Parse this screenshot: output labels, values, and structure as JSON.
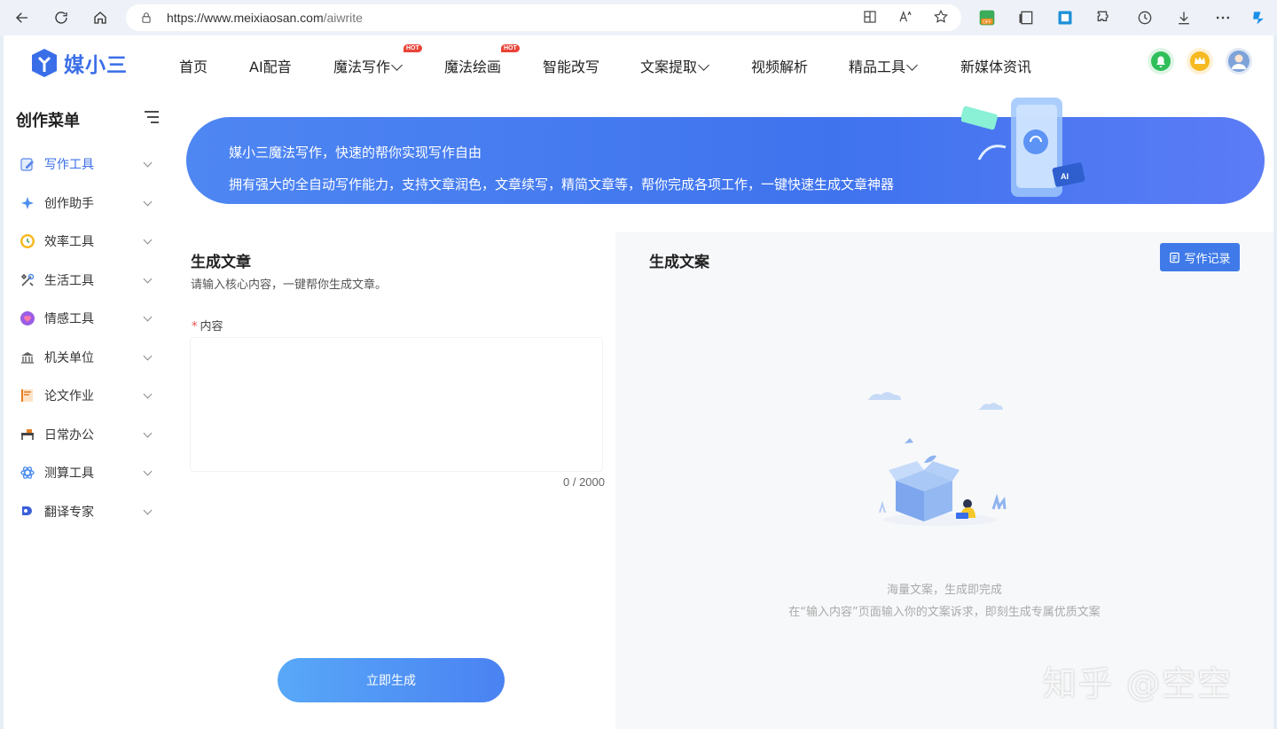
{
  "browser": {
    "url_host": "https://www.meixiaosan.com",
    "url_path": "/aiwrite"
  },
  "site": {
    "logo_text": "媒小三",
    "nav": [
      {
        "label": "首页",
        "hot": false,
        "dropdown": false
      },
      {
        "label": "AI配音",
        "hot": false,
        "dropdown": false
      },
      {
        "label": "魔法写作",
        "hot": true,
        "dropdown": true
      },
      {
        "label": "魔法绘画",
        "hot": true,
        "dropdown": false
      },
      {
        "label": "智能改写",
        "hot": false,
        "dropdown": false
      },
      {
        "label": "文案提取",
        "hot": false,
        "dropdown": true
      },
      {
        "label": "视频解析",
        "hot": false,
        "dropdown": false
      },
      {
        "label": "精品工具",
        "hot": false,
        "dropdown": true
      },
      {
        "label": "新媒体资讯",
        "hot": false,
        "dropdown": false
      }
    ],
    "hot_badge": "HOT"
  },
  "sidebar": {
    "title": "创作菜单",
    "items": [
      {
        "label": "写作工具",
        "active": true
      },
      {
        "label": "创作助手",
        "active": false
      },
      {
        "label": "效率工具",
        "active": false
      },
      {
        "label": "生活工具",
        "active": false
      },
      {
        "label": "情感工具",
        "active": false
      },
      {
        "label": "机关单位",
        "active": false
      },
      {
        "label": "论文作业",
        "active": false
      },
      {
        "label": "日常办公",
        "active": false
      },
      {
        "label": "测算工具",
        "active": false
      },
      {
        "label": "翻译专家",
        "active": false
      }
    ]
  },
  "banner": {
    "line1": "媒小三魔法写作，快速的帮你实现写作自由",
    "line2": "拥有强大的全自动写作能力，支持文章润色，文章续写，精简文章等，帮你完成各项工作，一键快速生成文章神器"
  },
  "form": {
    "title": "生成文章",
    "subtitle": "请输入核心内容，一键帮你生成文章。",
    "field_label": "内容",
    "required_mark": "*",
    "content_value": "",
    "counter": "0 / 2000",
    "generate_label": "立即生成"
  },
  "output": {
    "title": "生成文案",
    "record_label": "写作记录",
    "empty_line1": "海量文案，生成即完成",
    "empty_line2": "在“输入内容”页面输入你的文案诉求，即刻生成专属优质文案"
  },
  "watermark": "知乎 @空空",
  "colors": {
    "accent": "#3f7ae8",
    "banner": "#4a7ff0",
    "required": "#e94848",
    "hot": "#e9453a"
  }
}
